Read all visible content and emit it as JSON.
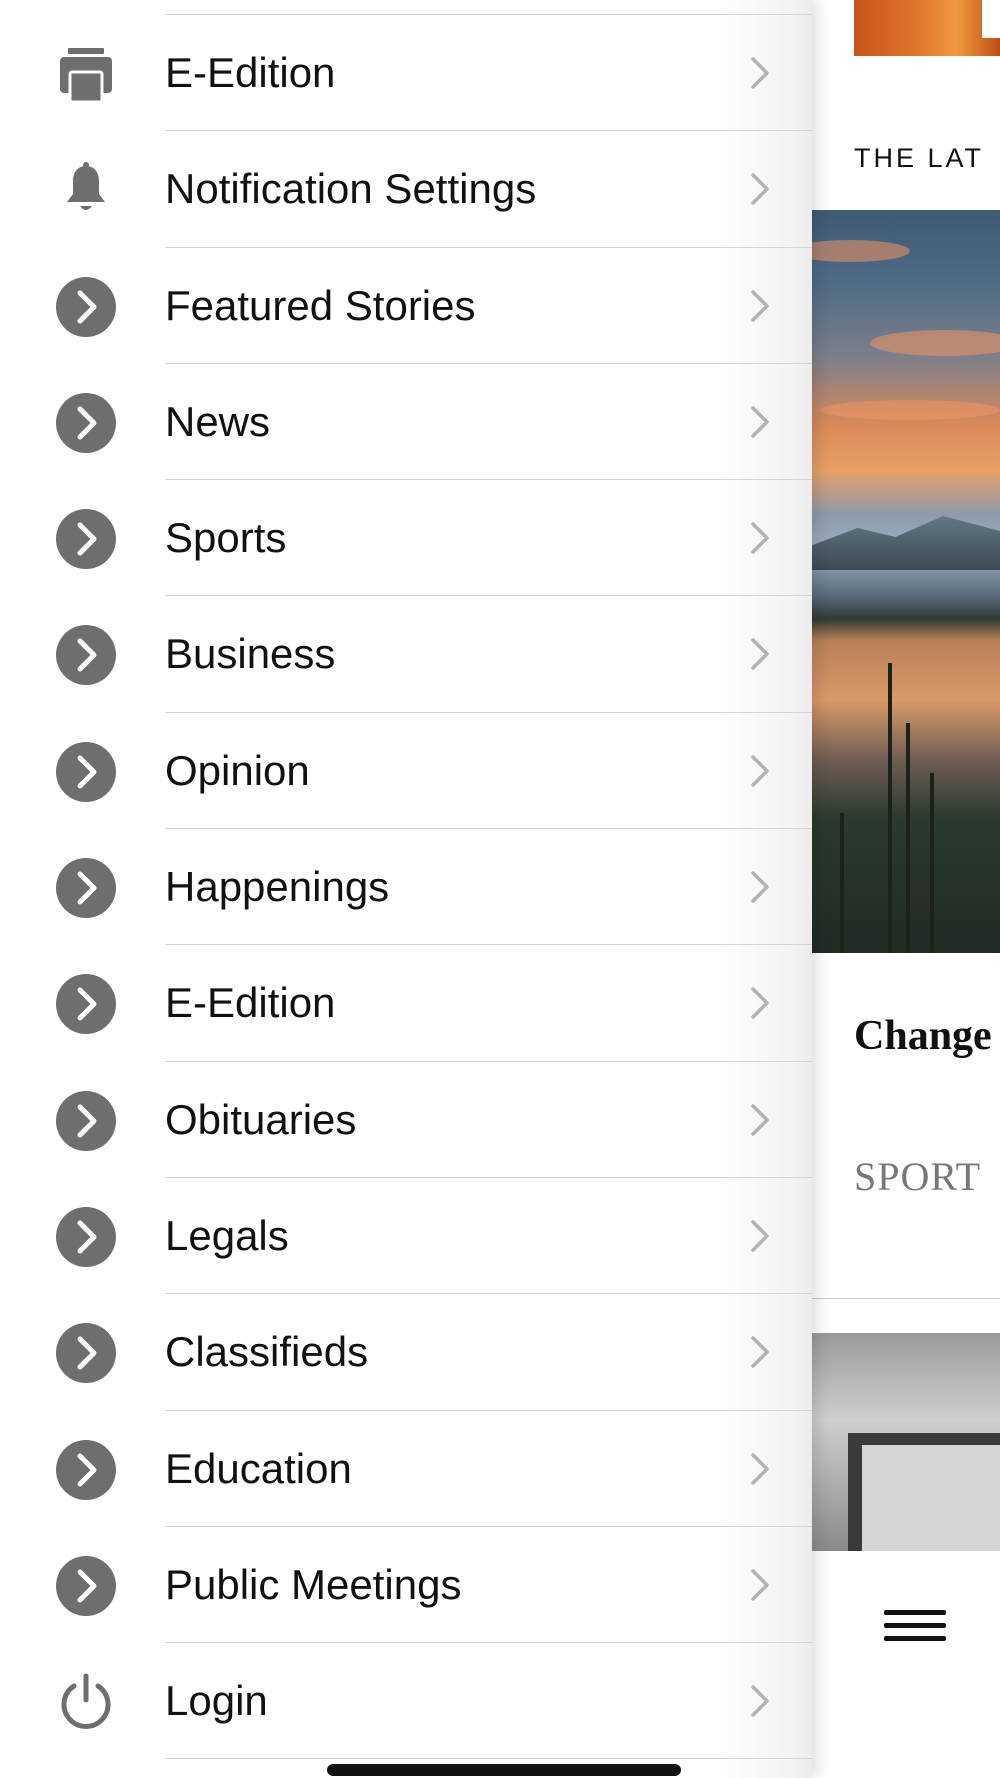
{
  "drawer": {
    "items": [
      {
        "label": "E-Edition",
        "icon": "printer-icon",
        "name": "menu-item-e-edition-top"
      },
      {
        "label": "Notification Settings",
        "icon": "bell-icon",
        "name": "menu-item-notification-settings"
      },
      {
        "label": "Featured Stories",
        "icon": "chevron-circle-icon",
        "name": "menu-item-featured-stories"
      },
      {
        "label": "News",
        "icon": "chevron-circle-icon",
        "name": "menu-item-news"
      },
      {
        "label": "Sports",
        "icon": "chevron-circle-icon",
        "name": "menu-item-sports"
      },
      {
        "label": "Business",
        "icon": "chevron-circle-icon",
        "name": "menu-item-business"
      },
      {
        "label": "Opinion",
        "icon": "chevron-circle-icon",
        "name": "menu-item-opinion"
      },
      {
        "label": "Happenings",
        "icon": "chevron-circle-icon",
        "name": "menu-item-happenings"
      },
      {
        "label": "E-Edition",
        "icon": "chevron-circle-icon",
        "name": "menu-item-e-edition"
      },
      {
        "label": "Obituaries",
        "icon": "chevron-circle-icon",
        "name": "menu-item-obituaries"
      },
      {
        "label": "Legals",
        "icon": "chevron-circle-icon",
        "name": "menu-item-legals"
      },
      {
        "label": "Classifieds",
        "icon": "chevron-circle-icon",
        "name": "menu-item-classifieds"
      },
      {
        "label": "Education",
        "icon": "chevron-circle-icon",
        "name": "menu-item-education"
      },
      {
        "label": "Public Meetings",
        "icon": "chevron-circle-icon",
        "name": "menu-item-public-meetings"
      },
      {
        "label": "Login",
        "icon": "power-icon",
        "name": "menu-item-login"
      }
    ]
  },
  "content": {
    "latest_label": "THE LAT",
    "headline": "Change",
    "section_tag": "SPORT"
  },
  "colors": {
    "icon_gray": "#6e6e6e",
    "chevron_gray": "#b3b3b3",
    "divider": "#d4d4d4"
  }
}
